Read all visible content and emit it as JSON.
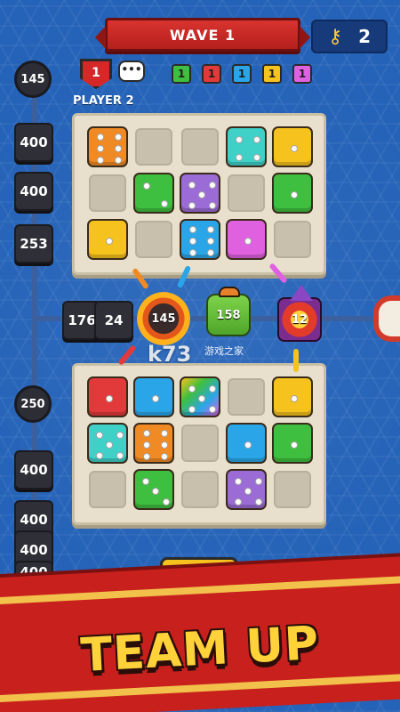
{
  "header": {
    "wave_label": "WAVE 1",
    "keys_count": "2",
    "key_icon": "key-icon"
  },
  "player": {
    "name": "PLAYER 2",
    "level": "1",
    "chat_icon": "•••"
  },
  "mini_dice": [
    {
      "value": "1",
      "color": "#3fbf3f"
    },
    {
      "value": "1",
      "color": "#e23a3a"
    },
    {
      "value": "1",
      "color": "#2aa6e8"
    },
    {
      "value": "1",
      "color": "#f6c21d"
    },
    {
      "value": "1",
      "color": "#e061e0"
    }
  ],
  "lane": {
    "circles": [
      "145",
      "250"
    ],
    "top_blocks": [
      "400",
      "400",
      "253"
    ],
    "bottom_blocks": [
      "400",
      "400",
      "400",
      "400"
    ]
  },
  "combat": {
    "blocks": [
      "176",
      "24"
    ],
    "enemy_blast_hp": "145",
    "enemy_goblin_hp": "158",
    "enemy_boss_hp": "12"
  },
  "colors": {
    "red": "#e23a3a",
    "orange": "#f08a24",
    "green": "#3fbf3f",
    "yellow": "#f6c21d",
    "blue": "#2aa6e8",
    "pink": "#e061e0",
    "purple": "#9b6bd6",
    "teal": "#3fd0c7"
  },
  "board_top": [
    [
      "orange",
      "empty",
      "empty",
      "teal",
      "yellow"
    ],
    [
      "empty",
      "green",
      "purple",
      "empty",
      "green"
    ],
    [
      "yellow",
      "empty",
      "blue",
      "pink",
      "empty"
    ]
  ],
  "board_bottom": [
    [
      "red",
      "blue",
      "rainbow",
      "empty",
      "yellow"
    ],
    [
      "teal",
      "orange",
      "empty",
      "blue",
      "green"
    ],
    [
      "empty",
      "green",
      "empty",
      "purple",
      "empty"
    ]
  ],
  "hud": {
    "level_badge": "1"
  },
  "watermark": {
    "text": "k73",
    "sub": "游戏之家"
  },
  "banner": {
    "headline": "TEAM UP"
  }
}
